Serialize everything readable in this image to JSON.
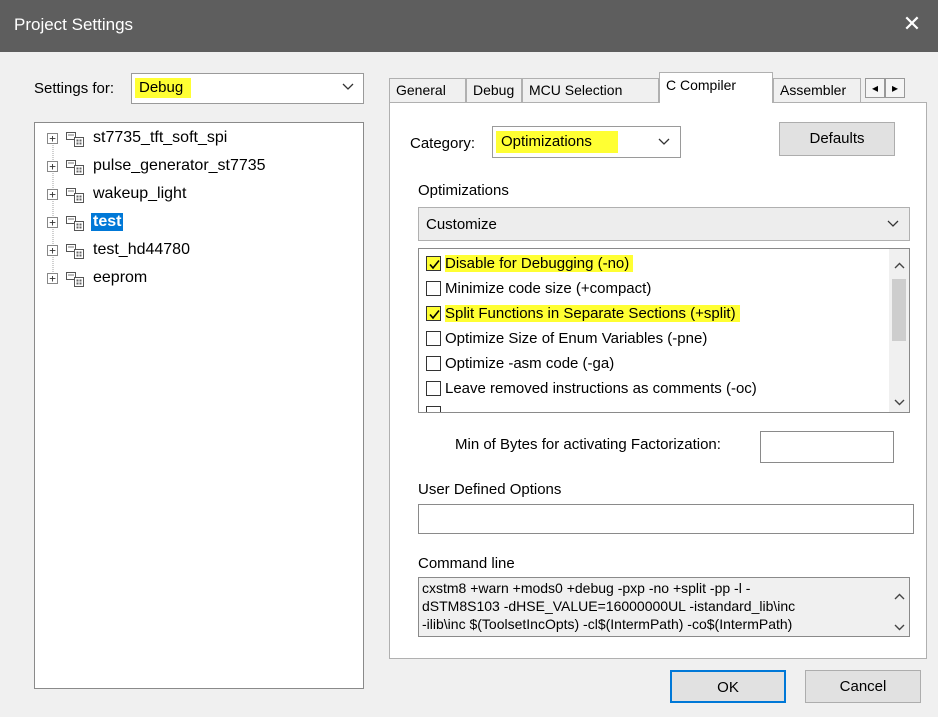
{
  "window": {
    "title": "Project Settings",
    "close_glyph": "✕"
  },
  "settings_for": {
    "label": "Settings for:",
    "value": "Debug"
  },
  "tree": {
    "items": [
      {
        "label": "st7735_tft_soft_spi",
        "selected": false
      },
      {
        "label": "pulse_generator_st7735",
        "selected": false
      },
      {
        "label": "wakeup_light",
        "selected": false
      },
      {
        "label": "test",
        "selected": true
      },
      {
        "label": "test_hd44780",
        "selected": false
      },
      {
        "label": "eeprom",
        "selected": false
      }
    ],
    "expander_glyph": "+",
    "node_icon": "project-icon"
  },
  "tabs": [
    {
      "label": "General",
      "active": false
    },
    {
      "label": "Debug",
      "active": false
    },
    {
      "label": "MCU Selection",
      "active": false
    },
    {
      "label": "C Compiler",
      "active": true
    },
    {
      "label": "Assembler",
      "active": false
    }
  ],
  "tab_scroll": {
    "left": "◂",
    "right": "▸"
  },
  "category": {
    "label": "Category:",
    "value": "Optimizations"
  },
  "defaults_button": "Defaults",
  "optimizations": {
    "label": "Optimizations",
    "mode": "Customize",
    "options": [
      {
        "label": "Disable for Debugging (-no)",
        "checked": true,
        "highlighted": true
      },
      {
        "label": "Minimize code size (+compact)",
        "checked": false,
        "highlighted": false
      },
      {
        "label": "Split Functions in Separate Sections (+split)",
        "checked": true,
        "highlighted": true
      },
      {
        "label": "Optimize Size of Enum Variables (-pne)",
        "checked": false,
        "highlighted": false
      },
      {
        "label": "Optimize -asm code (-ga)",
        "checked": false,
        "highlighted": false
      },
      {
        "label": "Leave removed instructions as comments (-oc)",
        "checked": false,
        "highlighted": false
      }
    ]
  },
  "factorization": {
    "label": "Min of Bytes for activating Factorization:",
    "value": ""
  },
  "user_defined": {
    "label": "User Defined Options",
    "value": ""
  },
  "command_line": {
    "label": "Command line",
    "lines": [
      "cxstm8 +warn +mods0 +debug -pxp -no +split -pp -l -",
      "dSTM8S103 -dHSE_VALUE=16000000UL -istandard_lib\\inc",
      "-ilib\\inc $(ToolsetIncOpts) -cl$(IntermPath) -co$(IntermPath)"
    ]
  },
  "buttons": {
    "ok": "OK",
    "cancel": "Cancel"
  },
  "colors": {
    "highlight": "#ffff33",
    "selection": "#0078d7",
    "titlebar": "#5e5e5e"
  }
}
